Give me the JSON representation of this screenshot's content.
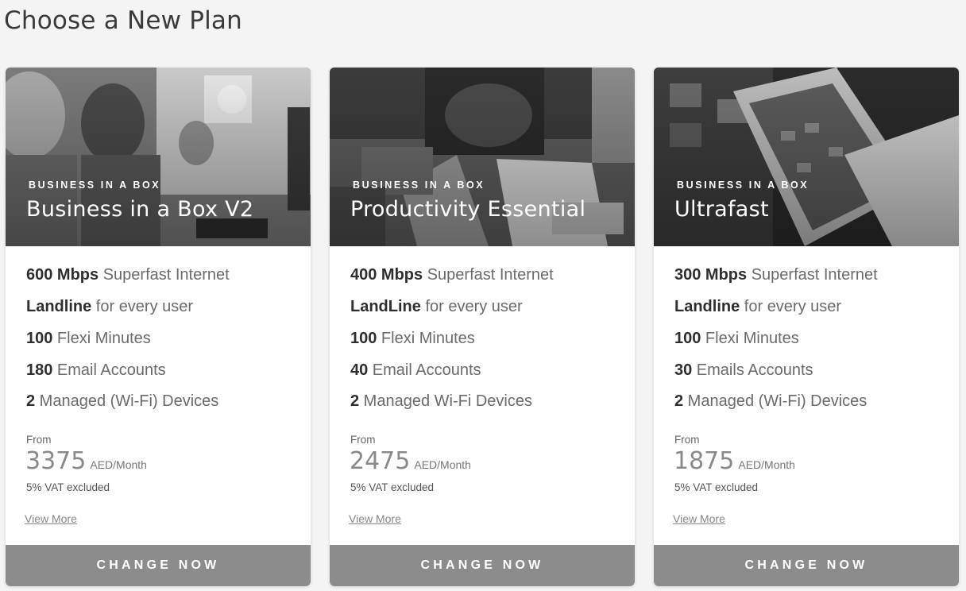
{
  "page": {
    "title": "Choose a New Plan"
  },
  "plans": [
    {
      "eyebrow": "BUSINESS IN A BOX",
      "name": "Business in a Box V2",
      "features": [
        {
          "bold": "600 Mbps",
          "text": " Superfast Internet"
        },
        {
          "bold": "Landline",
          "text": " for every user"
        },
        {
          "bold": "100",
          "text": " Flexi Minutes"
        },
        {
          "bold": "180",
          "text": " Email Accounts"
        },
        {
          "bold": "2",
          "text": " Managed (Wi-Fi) Devices"
        }
      ],
      "from_label": "From",
      "price": "3375",
      "unit": "AED/Month",
      "vat": "5% VAT excluded",
      "view_more": "View More",
      "cta": "CHANGE NOW"
    },
    {
      "eyebrow": "BUSINESS IN A BOX",
      "name": "Productivity Essential",
      "features": [
        {
          "bold": "400 Mbps",
          "text": " Superfast Internet"
        },
        {
          "bold": "LandLine",
          "text": " for every user"
        },
        {
          "bold": "100",
          "text": " Flexi Minutes"
        },
        {
          "bold": "40",
          "text": " Email Accounts"
        },
        {
          "bold": "2",
          "text": " Managed Wi-Fi Devices"
        }
      ],
      "from_label": "From",
      "price": "2475",
      "unit": "AED/Month",
      "vat": "5% VAT excluded",
      "view_more": "View More",
      "cta": "CHANGE NOW"
    },
    {
      "eyebrow": "BUSINESS IN A BOX",
      "name": "Ultrafast",
      "features": [
        {
          "bold": "300 Mbps",
          "text": " Superfast Internet"
        },
        {
          "bold": "Landline",
          "text": " for every user"
        },
        {
          "bold": "100",
          "text": " Flexi Minutes"
        },
        {
          "bold": "30",
          "text": " Emails Accounts"
        },
        {
          "bold": "2",
          "text": " Managed (Wi-Fi) Devices"
        }
      ],
      "from_label": "From",
      "price": "1875",
      "unit": "AED/Month",
      "vat": "5% VAT excluded",
      "view_more": "View More",
      "cta": "CHANGE NOW"
    }
  ]
}
